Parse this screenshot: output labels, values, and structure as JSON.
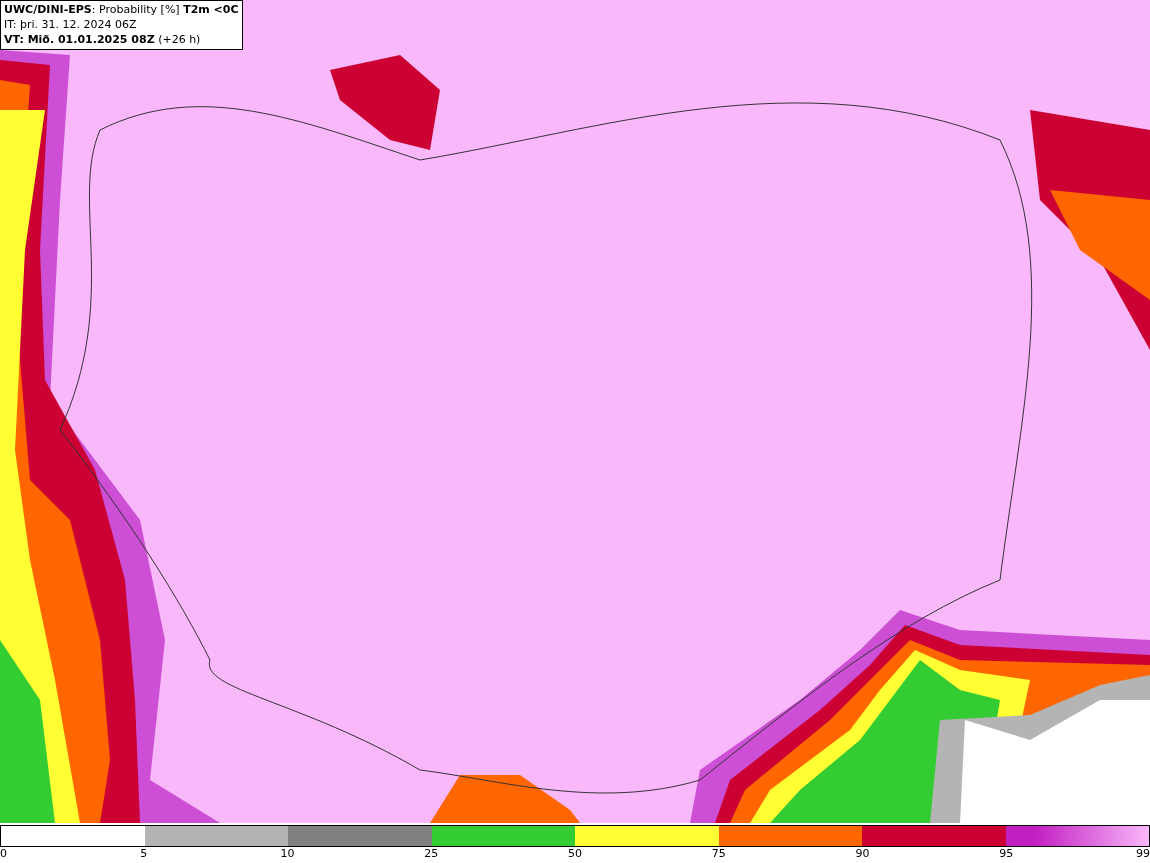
{
  "header": {
    "title": "**UWC/DINI-EPS**: Probability [%] **T2m <0C**",
    "issued": "IT: þri. 31. 12. 2024 06Z",
    "valid": "**VT: Mið. 01.01.2025 08Z** (+26 h)"
  },
  "legend": {
    "bands": [
      {
        "color": "#ffffff"
      },
      {
        "color": "#b4b4b4"
      },
      {
        "color": "#808080"
      },
      {
        "color": "#33cc33"
      },
      {
        "color": "#ffff33"
      },
      {
        "color": "#ff6600"
      },
      {
        "color": "#cc0033"
      },
      {
        "color": "#c21fc2"
      }
    ],
    "ticks": [
      "0",
      "5",
      "10",
      "25",
      "50",
      "75",
      "90",
      "95",
      "99"
    ]
  }
}
